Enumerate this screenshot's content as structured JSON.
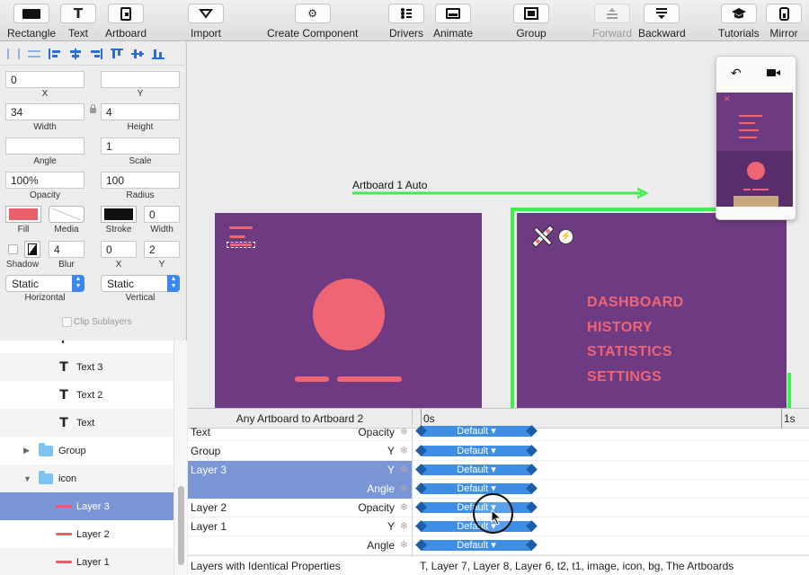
{
  "toolbar": {
    "rectangle": "Rectangle",
    "text": "Text",
    "artboard": "Artboard",
    "import": "Import",
    "create_component": "Create Component",
    "drivers": "Drivers",
    "animate": "Animate",
    "group": "Group",
    "forward": "Forward",
    "backward": "Backward",
    "tutorials": "Tutorials",
    "mirror": "Mirror"
  },
  "inspector": {
    "x": {
      "label": "X",
      "value": "0"
    },
    "y": {
      "label": "Y",
      "value": ""
    },
    "width": {
      "label": "Width",
      "value": "34"
    },
    "height": {
      "label": "Height",
      "value": "4"
    },
    "angle": {
      "label": "Angle",
      "value": ""
    },
    "scale": {
      "label": "Scale",
      "value": "1"
    },
    "opacity": {
      "label": "Opacity",
      "value": "100%"
    },
    "radius": {
      "label": "Radius",
      "value": "100"
    },
    "fill_label": "Fill",
    "media_label": "Media",
    "stroke_label": "Stroke",
    "stroke_width": {
      "label": "Width",
      "value": "0"
    },
    "shadow_label": "Shadow",
    "blur": {
      "label": "Blur",
      "value": "4"
    },
    "shadow_x": {
      "label": "X",
      "value": "0"
    },
    "shadow_y": {
      "label": "Y",
      "value": "2"
    },
    "horizontal": {
      "label": "Horizontal",
      "value": "Static"
    },
    "vertical": {
      "label": "Vertical",
      "value": "Static"
    },
    "clip_sublayers": "Clip Sublayers",
    "colors": {
      "fill": "#e8606c",
      "stroke": "#111111"
    }
  },
  "layers": {
    "items": [
      {
        "label": "Text 3"
      },
      {
        "label": "Text 2"
      },
      {
        "label": "Text"
      },
      {
        "label": "Group"
      },
      {
        "label": "icon"
      },
      {
        "label": "Layer 3"
      },
      {
        "label": "Layer 2"
      },
      {
        "label": "Layer 1"
      }
    ]
  },
  "canvas": {
    "connection_label": "Artboard 1 Auto",
    "menu_items": [
      "DASHBOARD",
      "HISTORY",
      "STATISTICS",
      "SETTINGS"
    ],
    "colors": {
      "artboard": "#6e3a82",
      "accent": "#ef6574",
      "connection": "#3ef04a"
    }
  },
  "timeline": {
    "header": "Any Artboard to Artboard 2",
    "start": "0s",
    "end": "1s",
    "rows": [
      {
        "name": "Text",
        "prop": "Opacity",
        "bar": "Default ▾"
      },
      {
        "name": "Group",
        "prop": "Y",
        "bar": "Default ▾"
      },
      {
        "name": "Layer 3",
        "prop": "Y",
        "bar": "Default ▾"
      },
      {
        "name": "",
        "prop": "Angle",
        "bar": "Default ▾"
      },
      {
        "name": "Layer 2",
        "prop": "Opacity",
        "bar": "Default ▾"
      },
      {
        "name": "Layer 1",
        "prop": "Y",
        "bar": "Default ▾"
      },
      {
        "name": "",
        "prop": "Angle",
        "bar": "Default ▾"
      }
    ],
    "identical_label": "Layers with Identical Properties",
    "identical_value": "T, Layer 7, Layer 8, Layer 6, t2, t1, image, icon, bg, The Artboards"
  }
}
